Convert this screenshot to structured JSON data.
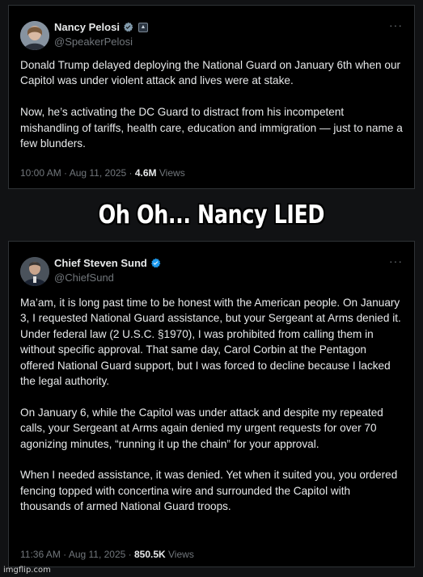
{
  "tweet1": {
    "name": "Nancy Pelosi",
    "handle": "@SpeakerPelosi",
    "paragraphs": [
      "Donald Trump delayed deploying the National Guard on January 6th when our Capitol was under violent attack and lives were at stake.",
      "Now, he’s activating the DC Guard to distract from his incompetent mishandling of tariffs, health care, education and immigration — just to name a few blunders."
    ],
    "time": "10:00 AM · Aug 11, 2025 · ",
    "views_count": "4.6M",
    "views_label": " Views"
  },
  "banner": {
    "text": "Oh Oh... Nancy LIED"
  },
  "tweet2": {
    "name": "Chief Steven Sund",
    "handle": "@ChiefSund",
    "paragraphs": [
      "Ma’am, it is long past time to be honest with the American people. On January 3, I requested National Guard assistance, but your Sergeant at Arms denied it. Under federal law (2 U.S.C. §1970), I was prohibited from calling them in without specific approval. That same day, Carol Corbin at the Pentagon offered National Guard support, but I was forced to decline because I lacked the legal authority.",
      "On January 6, while the Capitol was under attack and despite my repeated calls, your Sergeant at Arms again denied my urgent requests for over 70 agonizing minutes, “running it up the chain” for your approval.",
      "When I needed assistance, it was denied. Yet when it suited you, you ordered fencing topped with concertina wire and surrounded the Capitol with thousands of armed National Guard troops."
    ],
    "time": "11:36 AM · Aug 11, 2025 · ",
    "views_count": "850.5K",
    "views_label": " Views"
  },
  "watermark": "imgflip.com",
  "colors": {
    "verified": "#1d9bf0",
    "muted": "#71767b",
    "text": "#e7e9ea"
  }
}
